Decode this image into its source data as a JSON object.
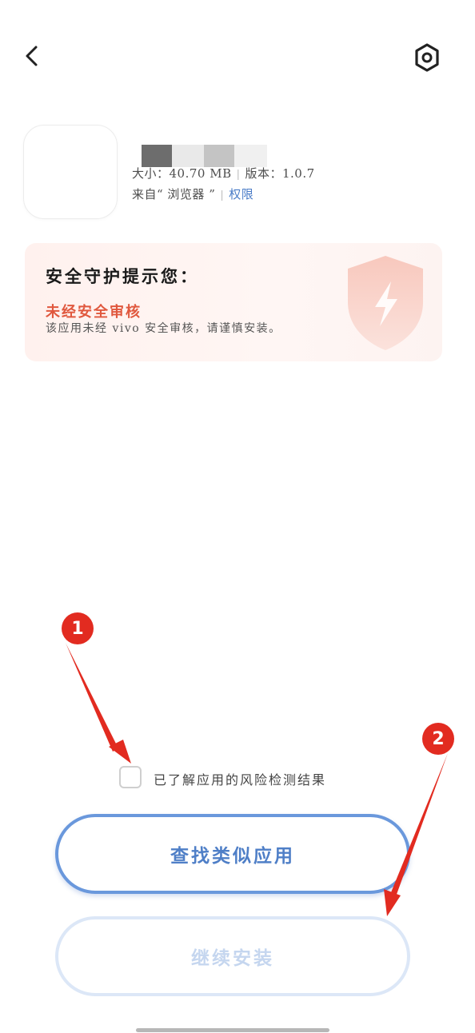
{
  "app": {
    "size_label": "大小：40.70 MB",
    "version_label": "版本：1.0.7",
    "source_label": "来自“ 浏览器 ”",
    "permission_link": "权限"
  },
  "security": {
    "title": "安全守护提示您：",
    "status": "未经安全审核",
    "description": "该应用未经 vivo 安全审核，请谨慎安装。"
  },
  "consent": {
    "label": "已了解应用的风险检测结果",
    "checked": false
  },
  "buttons": {
    "find_similar": "查找类似应用",
    "continue_install": "继续安装"
  },
  "annotations": {
    "marker_1": "1",
    "marker_2": "2",
    "marker_color": "#e22b20"
  },
  "colors": {
    "accent_blue": "#4f7fc7",
    "warning_red": "#e0583e"
  }
}
